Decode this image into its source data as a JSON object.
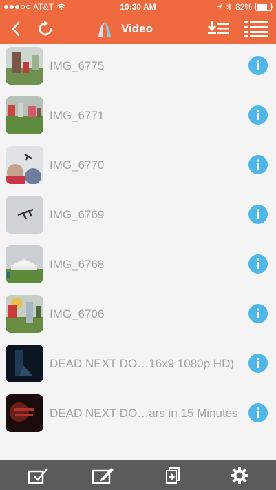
{
  "status_bar": {
    "carrier": "AT&T",
    "time": "10:30 AM",
    "battery_text": "82%",
    "battery_level": 0.82,
    "signal_bars_filled": 3,
    "signal_bars_total": 5
  },
  "nav": {
    "title": "Video",
    "back_icon": "chevron-left-icon",
    "refresh_icon": "refresh-icon",
    "app_logo": "app-logo-icon",
    "download_list_icon": "download-list-icon",
    "menu_icon": "menu-icon"
  },
  "videos": [
    {
      "name": "IMG_6775"
    },
    {
      "name": "IMG_6771"
    },
    {
      "name": "IMG_6770"
    },
    {
      "name": "IMG_6769"
    },
    {
      "name": "IMG_6768"
    },
    {
      "name": "IMG_6706"
    },
    {
      "name": "DEAD NEXT DO…16x9 1080p HD)"
    },
    {
      "name": "DEAD NEXT DO…ars in 15 Minutes"
    }
  ],
  "colors": {
    "header": "#f06a3f",
    "info": "#4fb6e8",
    "tabbar": "#5b5b5b",
    "label": "#a3a3a3"
  },
  "tabs": [
    {
      "icon": "select-check-icon"
    },
    {
      "icon": "edit-icon"
    },
    {
      "icon": "import-icon"
    },
    {
      "icon": "settings-gear-icon"
    }
  ]
}
